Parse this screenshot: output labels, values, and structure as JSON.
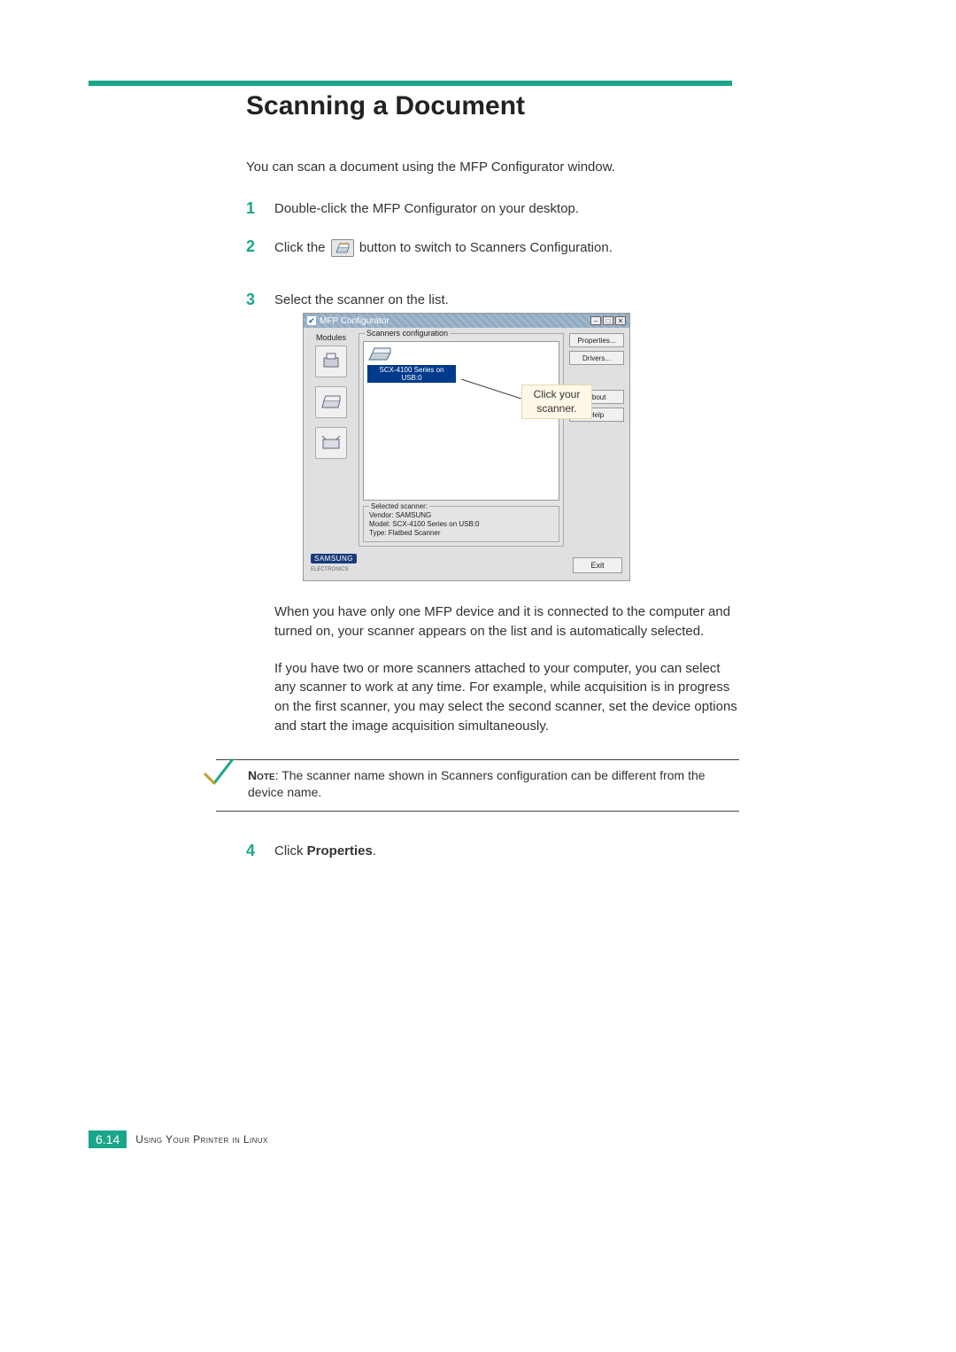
{
  "heading": "Scanning a Document",
  "intro": "You can scan a document using the MFP Configurator window.",
  "steps": {
    "s1": {
      "num": "1",
      "text": "Double-click the MFP Configurator on your desktop."
    },
    "s2": {
      "num": "2",
      "text_before": "Click the ",
      "text_after": " button to switch to Scanners Configuration."
    },
    "s3": {
      "num": "3",
      "text": "Select the scanner on the list."
    },
    "s4": {
      "num": "4",
      "text_before": "Click ",
      "bold": "Properties",
      "text_after": "."
    }
  },
  "callout": {
    "line1": "Click your",
    "line2": "scanner."
  },
  "mfp": {
    "title": "MFP Configurator",
    "modules_label": "Modules",
    "scanners_label": "Scanners configuration",
    "scanner_item": "SCX-4100 Series on USB:0",
    "buttons": {
      "properties": "Properties...",
      "drivers": "Drivers...",
      "about": "About",
      "help": "Help",
      "exit": "Exit"
    },
    "selected": {
      "title": "Selected scanner:",
      "vendor": "Vendor: SAMSUNG",
      "model": "Model: SCX-4100 Series on USB:0",
      "type": "Type: Flatbed Scanner"
    },
    "brand": "SAMSUNG",
    "brand_sub": "ELECTRONICS"
  },
  "para1": "When you have only one MFP device and it is connected to the computer and turned on, your scanner appears on the list and is automatically selected.",
  "para2": "If you have two or more scanners attached to your computer, you can select any scanner to work at any time. For example, while acquisition is in progress on the first scanner, you may select the second scanner, set the device options and start the image acquisition simultaneously.",
  "note": {
    "label": "Note",
    "text": ": The scanner name shown in Scanners configuration can be different from the device name."
  },
  "footer": {
    "page": "6.14",
    "text": "Using Your Printer in Linux"
  }
}
